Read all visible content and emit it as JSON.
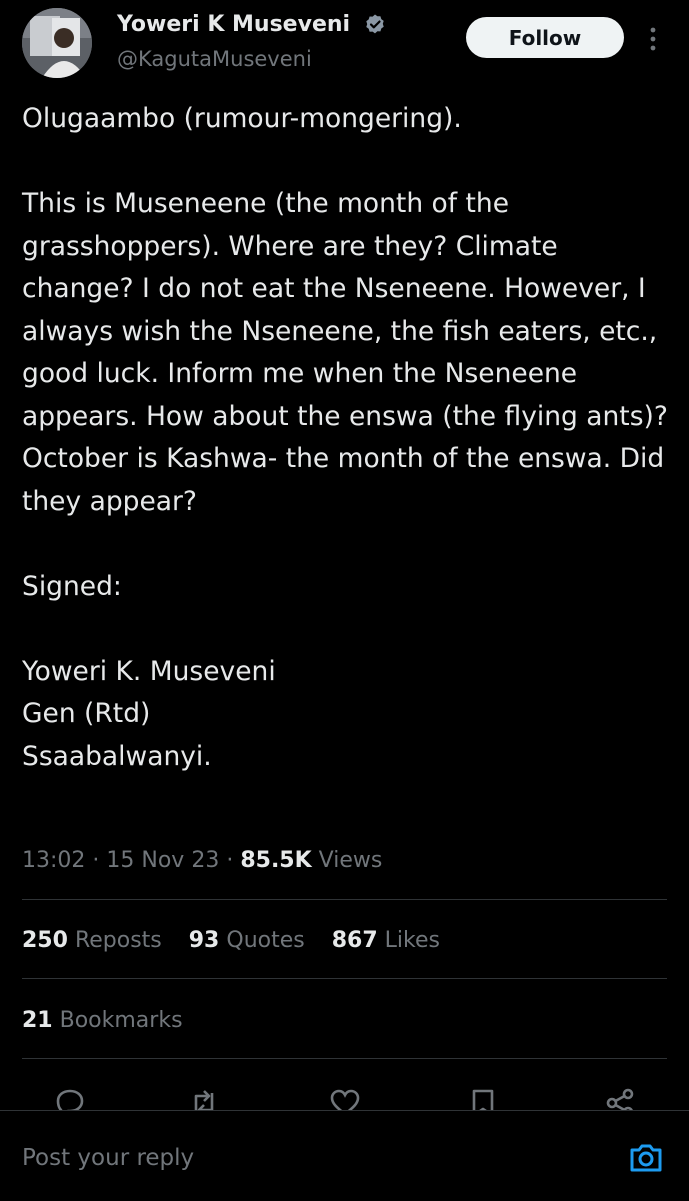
{
  "author": {
    "display_name": "Yoweri K Museveni",
    "handle": "@KagutaMuseveni",
    "verified_icon": "verified-badge-icon",
    "verified_color": "#8b98a5"
  },
  "follow_button": {
    "label": "Follow"
  },
  "more_menu": {
    "icon": "more-vertical-icon"
  },
  "post": {
    "paragraphs": [
      "Olugaambo (rumour-mongering).",
      "This is Museneene (the month of the grasshoppers). Where are they? Climate change? I do not eat the Nseneene. However, I always wish the Nseneene, the fish eaters, etc., good luck. Inform me when the Nseneene appears. How about the enswa (the flying ants)? October is Kashwa- the month of the enswa. Did they appear?",
      "Signed:"
    ],
    "signature": [
      "Yoweri K. Museveni",
      "Gen (Rtd)",
      "Ssaabalwanyi."
    ]
  },
  "meta": {
    "time": "13:02",
    "date": "15 Nov 23",
    "separator": "·",
    "views_count": "85.5K",
    "views_label": "Views"
  },
  "stats": {
    "reposts": {
      "count": "250",
      "label": "Reposts"
    },
    "quotes": {
      "count": "93",
      "label": "Quotes"
    },
    "likes": {
      "count": "867",
      "label": "Likes"
    },
    "bookmarks": {
      "count": "21",
      "label": "Bookmarks"
    }
  },
  "actions": [
    "reply-icon",
    "repost-icon",
    "like-icon",
    "bookmark-icon",
    "share-icon"
  ],
  "reply": {
    "placeholder": "Post your reply",
    "camera_icon": "camera-icon",
    "accent_color": "#1d9bf0"
  },
  "colors": {
    "background": "#000000",
    "text_primary": "#e7e9ea",
    "text_secondary": "#71767b",
    "divider": "#2f3336",
    "follow_bg": "#eff3f4"
  }
}
